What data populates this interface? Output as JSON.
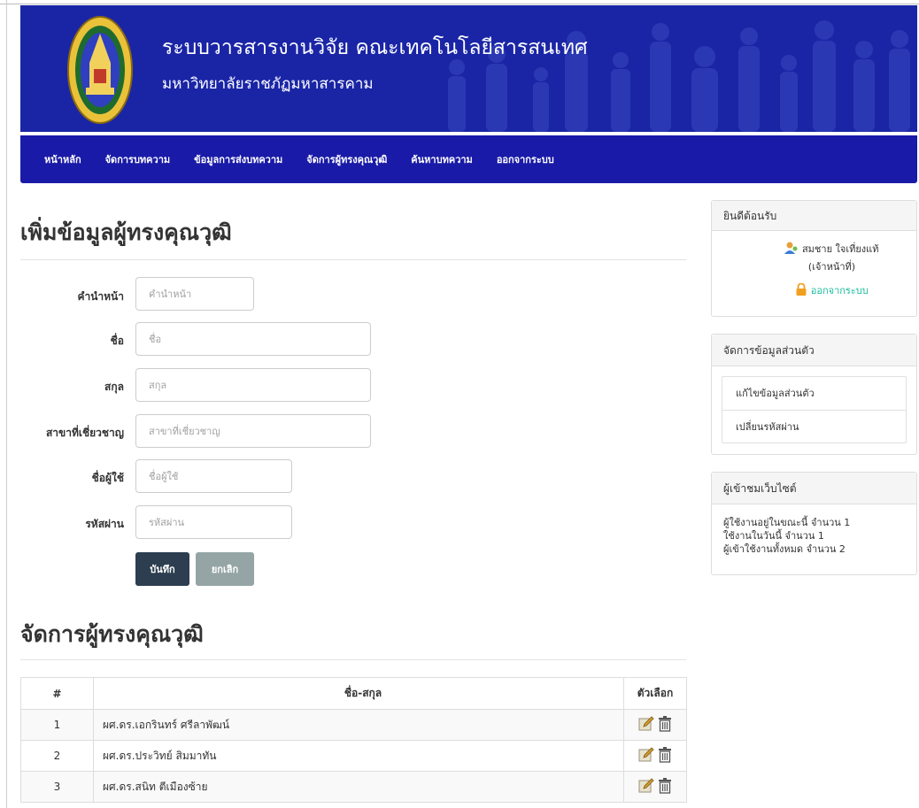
{
  "header": {
    "title": "ระบบวารสารงานวิจัย คณะเทคโนโลยีสารสนเทศ",
    "subtitle": "มหาวิทยาลัยราชภัฏมหาสารคาม",
    "logo_icon": "university-seal-icon",
    "banner_color": "#1a25a6"
  },
  "nav": {
    "items": [
      "หน้าหลัก",
      "จัดการบทความ",
      "ข้อมูลการส่งบทความ",
      "จัดการผู้ทรงคุณวุฒิ",
      "ค้นหาบทความ",
      "ออกจากระบบ"
    ]
  },
  "form": {
    "heading": "เพิ่มข้อมูลผู้ทรงคุณวุฒิ",
    "fields": [
      {
        "label": "คำนำหน้า",
        "placeholder": "คำนำหน้า",
        "value": ""
      },
      {
        "label": "ชื่อ",
        "placeholder": "ชื่อ",
        "value": ""
      },
      {
        "label": "สกุล",
        "placeholder": "สกุล",
        "value": ""
      },
      {
        "label": "สาขาที่เชี่ยวชาญ",
        "placeholder": "สาขาที่เชี่ยวชาญ",
        "value": ""
      },
      {
        "label": "ชื่อผู้ใช้",
        "placeholder": "ชื่อผู้ใช้",
        "value": ""
      },
      {
        "label": "รหัสผ่าน",
        "placeholder": "รหัสผ่าน",
        "value": ""
      }
    ],
    "save_label": "บันทึก",
    "cancel_label": "ยกเลิก"
  },
  "table": {
    "heading": "จัดการผู้ทรงคุณวุฒิ",
    "columns": [
      "#",
      "ชื่อ-สกุล",
      "ตัวเลือก"
    ],
    "rows": [
      {
        "num": "1",
        "name": "ผศ.ดร.เอกรินทร์ ศรีลาพัฒน์"
      },
      {
        "num": "2",
        "name": "ผศ.ดร.ประวิทย์ สิมมาทัน"
      },
      {
        "num": "3",
        "name": "ผศ.ดร.สนิท ตีเมืองซ้าย"
      }
    ],
    "row_icons": [
      "edit-icon",
      "trash-icon"
    ]
  },
  "sidebar": {
    "welcome": {
      "title": "ยินดีต้อนรับ",
      "user_name": "สมชาย ใจเที่ยงแท้",
      "role": "(เจ้าหน้าที่)",
      "logout_label": "ออกจากระบบ",
      "accent": "#18bc9c"
    },
    "profile": {
      "title": "จัดการข้อมูลส่วนตัว",
      "items": [
        "แก้ไขข้อมูลส่วนตัว",
        "เปลี่ยนรหัสผ่าน"
      ]
    },
    "visitors": {
      "title": "ผู้เข้าชมเว็บไซต์",
      "lines": [
        "ผู้ใช้งานอยู่ในขณะนี้ จำนวน 1",
        "ใช้งานในวันนี้ จำนวน 1",
        "ผู้เข้าใช้งานทั้งหมด จำนวน 2"
      ]
    }
  }
}
